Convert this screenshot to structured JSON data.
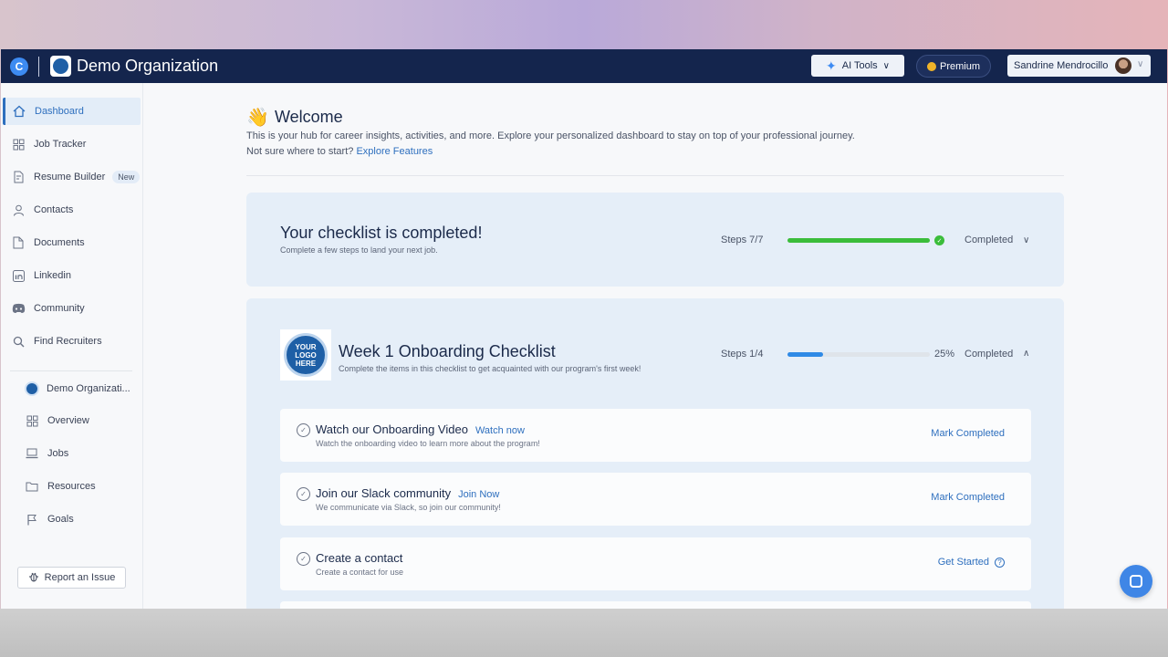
{
  "topbar": {
    "brand_letter": "C",
    "org_name": "Demo Organization",
    "ai_tools_label": "AI Tools",
    "premium_label": "Premium",
    "user_name": "Sandrine Mendrocillo"
  },
  "sidebar": {
    "items": [
      {
        "label": "Dashboard",
        "icon": "home-icon"
      },
      {
        "label": "Job Tracker",
        "icon": "grid-icon"
      },
      {
        "label": "Resume Builder",
        "icon": "resume-icon",
        "badge": "New"
      },
      {
        "label": "Contacts",
        "icon": "person-icon"
      },
      {
        "label": "Documents",
        "icon": "document-icon"
      },
      {
        "label": "Linkedin",
        "icon": "linkedin-icon"
      },
      {
        "label": "Community",
        "icon": "discord-icon"
      },
      {
        "label": "Find Recruiters",
        "icon": "search-icon"
      }
    ],
    "org_items": [
      {
        "label": "Demo Organizati..."
      },
      {
        "label": "Overview",
        "icon": "grid-icon"
      },
      {
        "label": "Jobs",
        "icon": "laptop-icon"
      },
      {
        "label": "Resources",
        "icon": "folder-icon"
      },
      {
        "label": "Goals",
        "icon": "flag-icon"
      }
    ],
    "report_label": "Report an Issue"
  },
  "welcome": {
    "title": "Welcome",
    "desc": "This is your hub for career insights, activities, and more. Explore your personalized dashboard to stay on top of your professional journey.",
    "prompt": "Not sure where to start?",
    "link": "Explore Features"
  },
  "checklist_main": {
    "title": "Your checklist is completed!",
    "subtitle": "Complete a few steps to land your next job.",
    "steps": "Steps 7/7",
    "progress": 1.0,
    "status": "Completed"
  },
  "checklist_week1": {
    "logo_text": "YOUR LOGO HERE",
    "title": "Week 1 Onboarding Checklist",
    "subtitle": "Complete the items in this checklist to get acquainted with our program's first week!",
    "steps": "Steps 1/4",
    "progress": 0.25,
    "percent": "25%",
    "status": "Completed",
    "tasks": [
      {
        "title": "Watch our Onboarding Video",
        "link": "Watch now",
        "desc": "Watch the onboarding video to learn more about the program!",
        "action": "Mark Completed"
      },
      {
        "title": "Join our Slack community",
        "link": "Join Now",
        "desc": "We communicate via Slack, so join our community!",
        "action": "Mark Completed"
      },
      {
        "title": "Create a contact",
        "link": "",
        "desc": "Create a contact for use",
        "action": "Get Started"
      }
    ]
  },
  "colors": {
    "topbar": "#14254d",
    "accent": "#2e6fbe",
    "success": "#3bbd3b",
    "progress_blue": "#2f8ae6"
  }
}
